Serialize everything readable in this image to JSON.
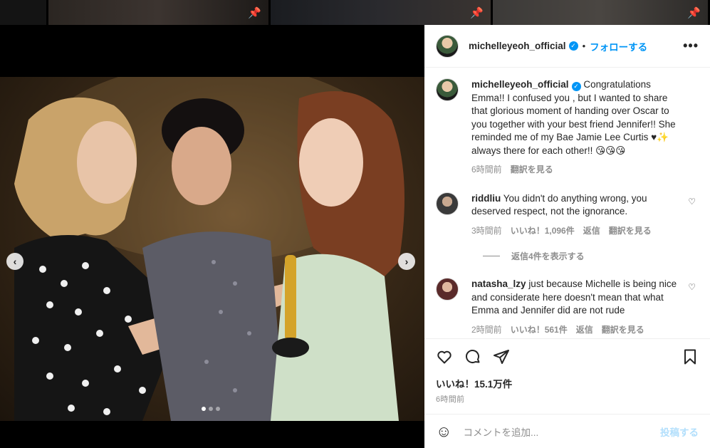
{
  "header": {
    "username": "michelleyeoh_official",
    "follow_label": "フォローする",
    "separator": "•",
    "more_label": "•••"
  },
  "media": {
    "prev_label": "‹",
    "next_label": "›",
    "slide_count": 3,
    "active_slide": 1
  },
  "caption": {
    "username": "michelleyeoh_official",
    "text": "Congratulations Emma!! I confused you , but I wanted to share that glorious moment of handing over Oscar to you together with your best friend Jennifer!! She reminded me of my Bae Jamie Lee Curtis ♥✨ always there for each other!! 😘😘😘",
    "time": "6時間前",
    "translate": "翻訳を見る"
  },
  "comments": [
    {
      "username": "riddliu",
      "text": "You didn't do anything wrong, you deserved respect, not the ignorance.",
      "time": "3時間前",
      "likes": "いいね！1,096件",
      "reply": "返信",
      "translate": "翻訳を見る",
      "view_replies": "返信4件を表示する"
    },
    {
      "username": "natasha_lzy",
      "text": "just because Michelle is being nice and considerate here doesn't mean that what Emma and Jennifer did are not rude",
      "time": "2時間前",
      "likes": "いいね！561件",
      "reply": "返信",
      "translate": "翻訳を見る"
    }
  ],
  "post": {
    "likes": "いいね！15.1万件",
    "time": "6時間前"
  },
  "composer": {
    "placeholder": "コメントを追加...",
    "post_label": "投稿する"
  },
  "colors": {
    "accent": "#0095f6",
    "muted": "#8e8e8e",
    "post_disabled": "#b2dffc"
  }
}
